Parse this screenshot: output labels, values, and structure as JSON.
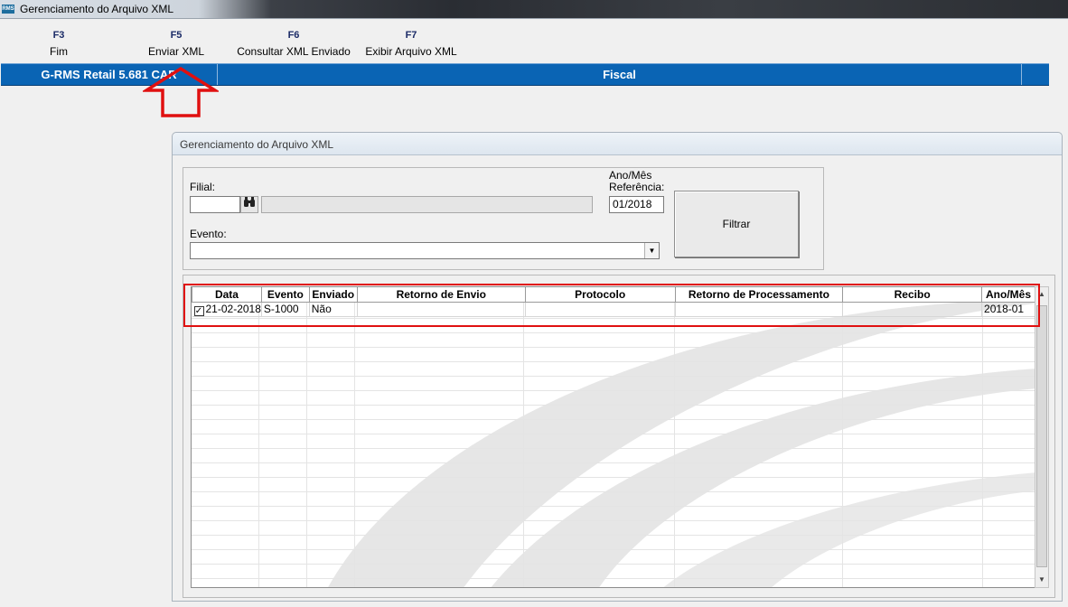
{
  "window": {
    "title": "Gerenciamento do Arquivo XML",
    "icon": "rms-app-icon",
    "icon_text": "RMS"
  },
  "toolbar": {
    "items": [
      {
        "key": "F3",
        "label": "Fim"
      },
      {
        "key": "F5",
        "label": "Enviar XML"
      },
      {
        "key": "F6",
        "label": "Consultar XML Enviado"
      },
      {
        "key": "F7",
        "label": "Exibir Arquivo XML"
      }
    ]
  },
  "statusbar": {
    "product": "G-RMS Retail 5.681 CAR",
    "module": "Fiscal",
    "color": "#0a64b4"
  },
  "child_window": {
    "title": "Gerenciamento do Arquivo XML",
    "filial_label": "Filial:",
    "filial_value": "",
    "ano_mes_label_1": "Ano/Mês",
    "ano_mes_label_2": "Referência:",
    "ano_mes_value": "01/2018",
    "evento_label": "Evento:",
    "evento_value": "",
    "filtrar_label": "Filtrar",
    "icons": {
      "search": "binoculars-icon",
      "dropdown": "chevron-down-icon"
    }
  },
  "grid": {
    "columns": [
      "Data",
      "Evento",
      "Enviado",
      "Retorno de Envio",
      "Protocolo",
      "Retorno de Processamento",
      "Recibo",
      "Ano/Mês"
    ],
    "rows": [
      {
        "checked": true,
        "Data": "21-02-2018",
        "Evento": "S-1000",
        "Enviado": "Não",
        "Retorno de Envio": "",
        "Protocolo": "",
        "Retorno de Processamento": "",
        "Recibo": "",
        "Ano/Mês": "2018-01"
      }
    ]
  },
  "annotations": {
    "highlight_color": "#e01010",
    "arrow_target": "Enviar XML"
  }
}
